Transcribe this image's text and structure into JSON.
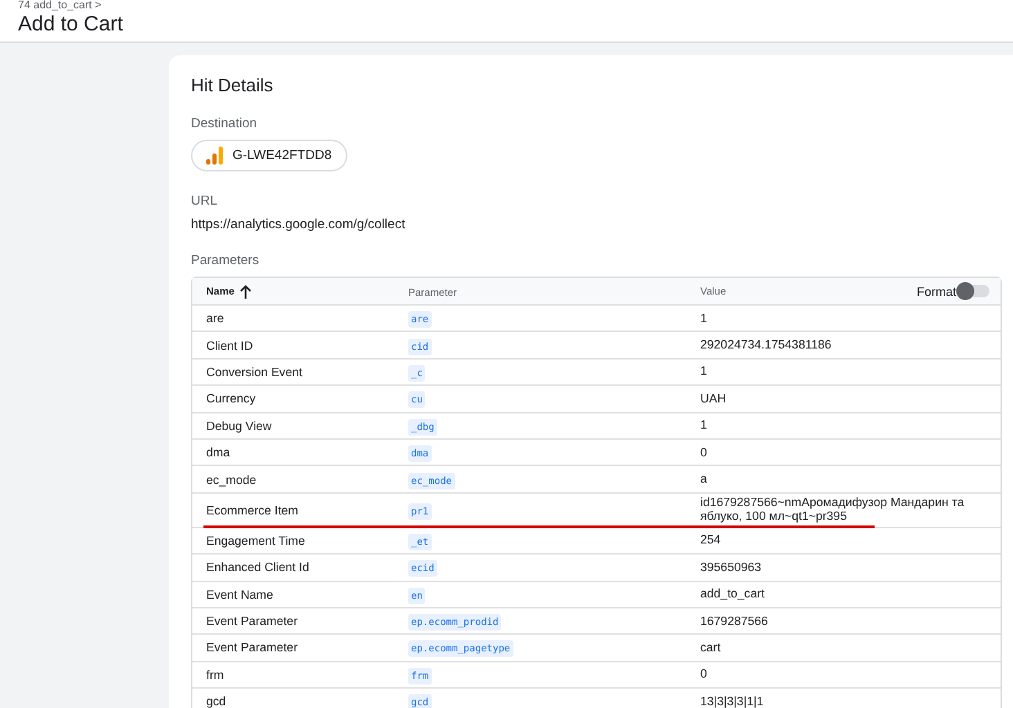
{
  "breadcrumb": "74 add_to_cart >",
  "title": "Add to Cart",
  "card": {
    "heading": "Hit Details",
    "destination_label": "Destination",
    "destination": "G-LWE42FTDD8",
    "url_label": "URL",
    "url": "https://analytics.google.com/g/collect",
    "parameters_label": "Parameters"
  },
  "table": {
    "columns": [
      "Name",
      "Parameter",
      "Value"
    ],
    "format_toggle": {
      "label": "Format",
      "on": false
    },
    "rows": [
      {
        "name": "are",
        "parameter": "are",
        "value": "1"
      },
      {
        "name": "Client ID",
        "parameter": "cid",
        "value": "292024734.1754381186"
      },
      {
        "name": "Conversion Event",
        "parameter": "_c",
        "value": "1"
      },
      {
        "name": "Currency",
        "parameter": "cu",
        "value": "UAH"
      },
      {
        "name": "Debug View",
        "parameter": "_dbg",
        "value": "1"
      },
      {
        "name": "dma",
        "parameter": "dma",
        "value": "0"
      },
      {
        "name": "ec_mode",
        "parameter": "ec_mode",
        "value": "a"
      },
      {
        "name": "Ecommerce Item",
        "parameter": "pr1",
        "value": "id1679287566~nmАромадифузор Мандарин та яблуко, 100 мл~qt1~pr395"
      },
      {
        "name": "Engagement Time",
        "parameter": "_et",
        "value": "254"
      },
      {
        "name": "Enhanced Client Id",
        "parameter": "ecid",
        "value": "395650963"
      },
      {
        "name": "Event Name",
        "parameter": "en",
        "value": "add_to_cart"
      },
      {
        "name": "Event Parameter",
        "parameter": "ep.ecomm_prodid",
        "value": "1679287566"
      },
      {
        "name": "Event Parameter",
        "parameter": "ep.ecomm_pagetype",
        "value": "cart"
      },
      {
        "name": "frm",
        "parameter": "frm",
        "value": "0"
      },
      {
        "name": "gcd",
        "parameter": "gcd",
        "value": "13|3|3|3|1|1"
      }
    ]
  }
}
